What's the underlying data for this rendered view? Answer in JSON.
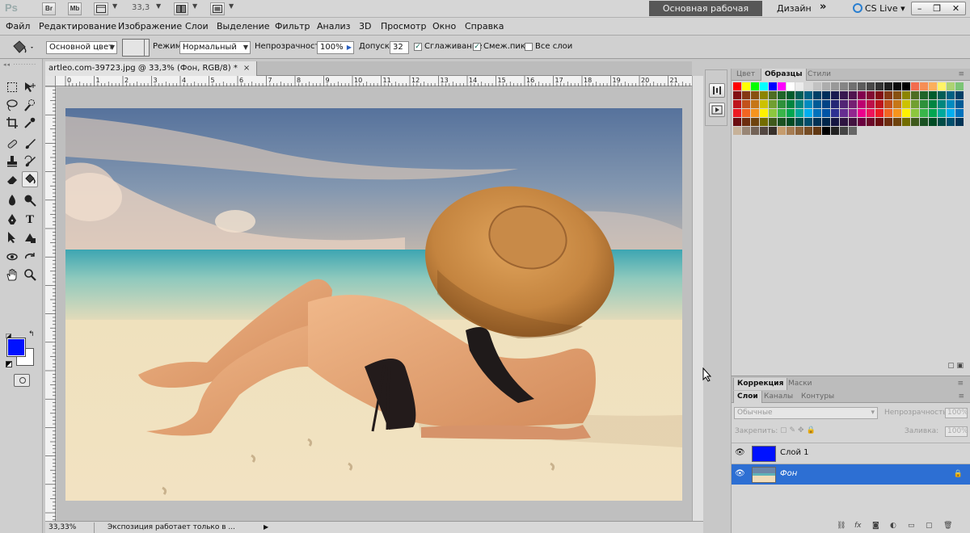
{
  "app": {
    "logo": "Ps",
    "bridge_btn": "Br",
    "minibridge_btn": "Mb",
    "zoom_level": "33,3",
    "workspace_active": "Основная рабочая среда",
    "workspace_design": "Дизайн",
    "workspace_more": "»",
    "cs_live": "CS Live"
  },
  "menu": [
    "Файл",
    "Редактирование",
    "Изображение",
    "Слои",
    "Выделение",
    "Фильтр",
    "Анализ",
    "3D",
    "Просмотр",
    "Окно",
    "Справка"
  ],
  "options": {
    "fill_source": "Основной цвет",
    "mode_label": "Режим:",
    "mode_value": "Нормальный",
    "opacity_label": "Непрозрачность:",
    "opacity_value": "100%",
    "tolerance_label": "Допуск:",
    "tolerance_value": "32",
    "antialias_label": "Сглаживание",
    "antialias_checked": true,
    "contiguous_label": "Смеж.пикс",
    "contiguous_checked": true,
    "all_layers_label": "Все слои",
    "all_layers_checked": false
  },
  "document": {
    "tab_title": "artleo.com-39723.jpg @ 33,3% (Фон, RGB/8) *",
    "close": "×",
    "ruler_numbers": [
      "0",
      "1",
      "2",
      "3",
      "4",
      "5",
      "6",
      "7",
      "8",
      "9",
      "10",
      "11",
      "12",
      "13",
      "14",
      "15",
      "16",
      "17",
      "18",
      "19",
      "20",
      "21"
    ]
  },
  "status": {
    "zoom": "33,33%",
    "message": "Экспозиция работает только в ..."
  },
  "colors": {
    "foreground": "#0011ff",
    "background": "#ffffff",
    "selected_layer": "#2d6fd3"
  },
  "swatch_panel": {
    "tabs": [
      "Цвет",
      "Образцы",
      "Стили"
    ],
    "active_tab": "Образцы"
  },
  "adjust_panel": {
    "tabs": [
      "Коррекция",
      "Маски"
    ],
    "active_tab": "Коррекция"
  },
  "layers_panel": {
    "tabs": [
      "Слои",
      "Каналы",
      "Контуры"
    ],
    "active_tab": "Слои",
    "blend_mode": "Обычные",
    "opacity_label": "Непрозрачность:",
    "opacity_value": "100%",
    "lock_label": "Закрепить:",
    "fill_label": "Заливка:",
    "fill_value": "100%",
    "layers": [
      {
        "name": "Слой 1",
        "visible": true,
        "selected": false,
        "thumb": "#0011ff"
      },
      {
        "name": "Фон",
        "visible": true,
        "selected": true,
        "thumb": "photo"
      }
    ]
  }
}
